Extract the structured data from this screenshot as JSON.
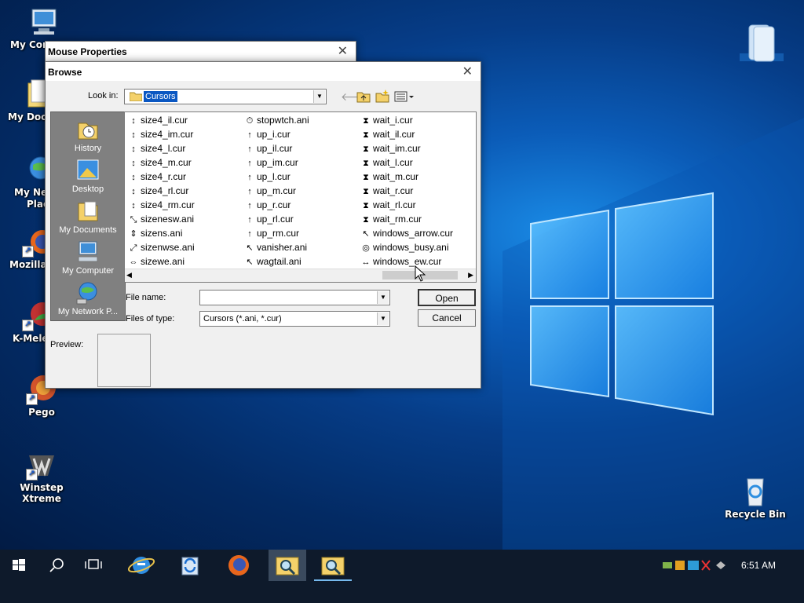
{
  "desktop": {
    "icons": [
      {
        "label": "My Com",
        "icon": "monitor-icon"
      },
      {
        "label": "My Doc",
        "icon": "folder-icon"
      },
      {
        "label": "My Ne",
        "label2": "Plac",
        "icon": "globe-icon"
      },
      {
        "label": "Mozilla",
        "icon": "firefox-icon"
      },
      {
        "label": "K-Mele",
        "icon": "kmeleon-icon"
      },
      {
        "label": "Pego",
        "icon": "pego-icon"
      },
      {
        "label": "Winstep Xtreme",
        "icon": "winstep-icon"
      },
      {
        "label": "Recycle Bin",
        "icon": "recycle-bin-icon"
      }
    ]
  },
  "mouse_properties": {
    "title": "Mouse Properties"
  },
  "browse": {
    "title": "Browse",
    "look_in_label": "Look in:",
    "look_in_value": "Cursors",
    "places": [
      "History",
      "Desktop",
      "My Documents",
      "My Computer",
      "My Network P..."
    ],
    "files_col1": [
      "size4_il.cur",
      "size4_im.cur",
      "size4_l.cur",
      "size4_m.cur",
      "size4_r.cur",
      "size4_rl.cur",
      "size4_rm.cur",
      "sizenesw.ani",
      "sizens.ani",
      "sizenwse.ani",
      "sizewe.ani"
    ],
    "files_col2": [
      "stopwtch.ani",
      "up_i.cur",
      "up_il.cur",
      "up_im.cur",
      "up_l.cur",
      "up_m.cur",
      "up_r.cur",
      "up_rl.cur",
      "up_rm.cur",
      "vanisher.ani",
      "wagtail.ani"
    ],
    "files_col3": [
      "wait_i.cur",
      "wait_il.cur",
      "wait_im.cur",
      "wait_l.cur",
      "wait_m.cur",
      "wait_r.cur",
      "wait_rl.cur",
      "wait_rm.cur",
      "windows_arrow.cur",
      "windows_busy.ani",
      "windows_ew.cur"
    ],
    "file_name_label": "File name:",
    "file_name_value": "",
    "files_of_type_label": "Files of type:",
    "files_of_type_value": "Cursors (*.ani, *.cur)",
    "open_label": "Open",
    "cancel_label": "Cancel",
    "preview_label": "Preview:"
  },
  "taskbar": {
    "clock": "6:51 AM",
    "apps": [
      "start-icon",
      "search-icon",
      "task-view-icon",
      "ie-icon",
      "sync-icon",
      "firefox-icon",
      "magnifier-folder-icon",
      "magnifier-folder-icon"
    ]
  },
  "colors": {
    "accent": "#0078d7",
    "places_bg": "#808080",
    "desktop": "#063d88"
  }
}
